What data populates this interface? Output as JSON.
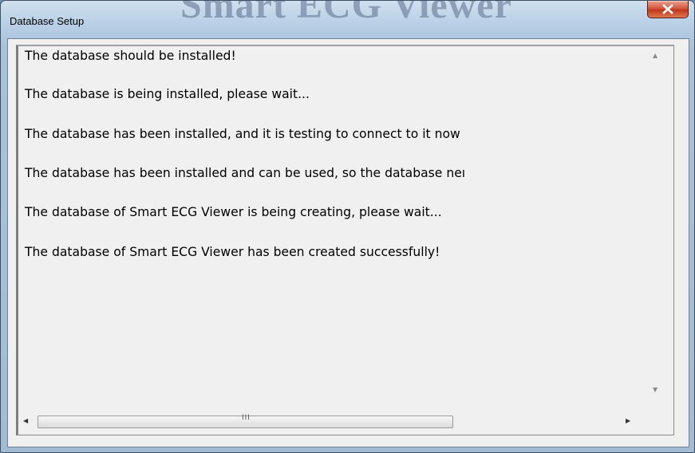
{
  "window": {
    "title": "Database Setup",
    "background_brand": "Smart ECG Viewer"
  },
  "log": {
    "lines": [
      "The database should be installed!",
      "The database is being installed, please wait...",
      "The database has been installed, and it is testing to connect to it now",
      "The database has been installed and can be used, so the database neı",
      "The database of Smart ECG Viewer is being creating, please wait...",
      "The database of Smart ECG Viewer has been created successfully!"
    ]
  },
  "scrollbar": {
    "grip": "III"
  },
  "icons": {
    "close": "close-icon",
    "scroll_up": "scroll-up-arrow-icon",
    "scroll_down": "scroll-down-arrow-icon",
    "scroll_left": "scroll-left-arrow-icon",
    "scroll_right": "scroll-right-arrow-icon"
  },
  "colors": {
    "close_button": "#c2371d",
    "frame": "#b9d0e6",
    "client": "#f0f0f0"
  }
}
